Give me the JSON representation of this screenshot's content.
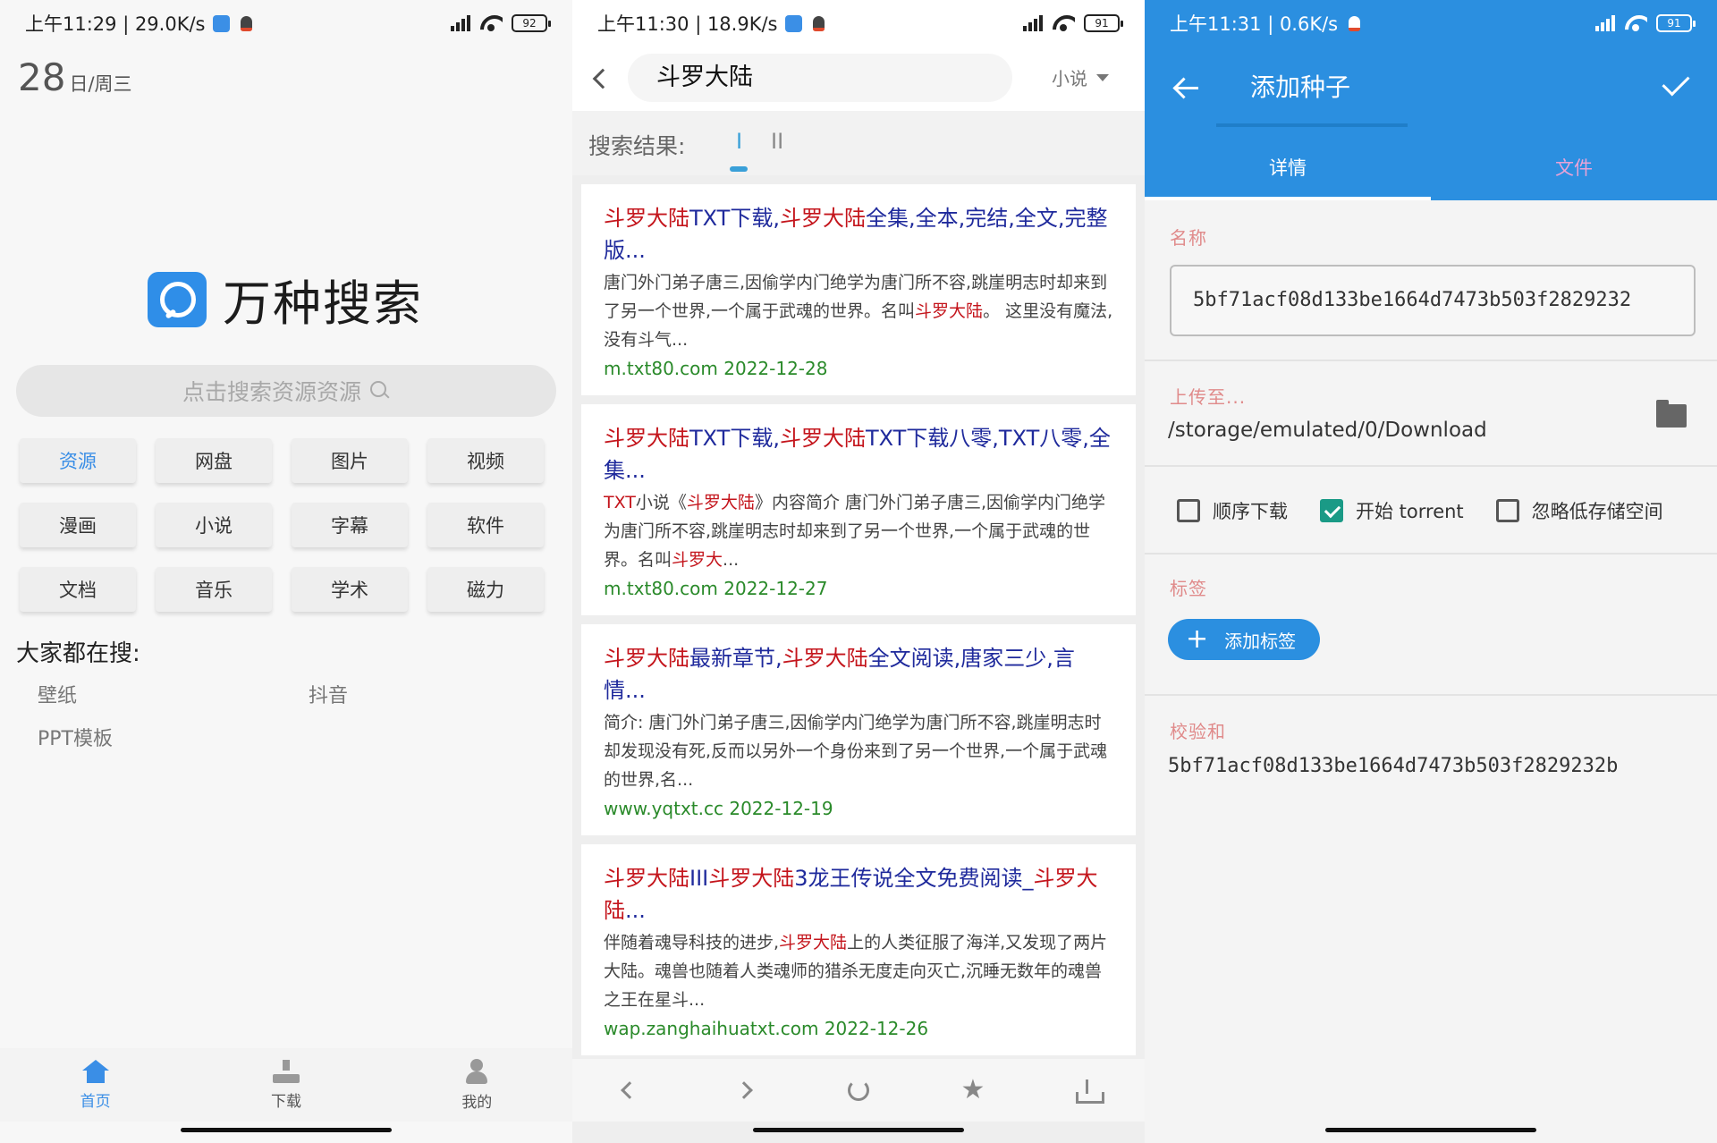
{
  "panel1": {
    "status": {
      "text": "上午11:29 | 29.0K/s",
      "battery": "92"
    },
    "date": {
      "day": "28",
      "weekday": "日/周三"
    },
    "app_name": "万种搜索",
    "search_placeholder": "点击搜索资源资源",
    "categories": [
      "资源",
      "网盘",
      "图片",
      "视频",
      "漫画",
      "小说",
      "字幕",
      "软件",
      "文档",
      "音乐",
      "学术",
      "磁力"
    ],
    "hot_title": "大家都在搜:",
    "hot_items": [
      "壁纸",
      "抖音",
      "PPT模板"
    ],
    "nav": [
      "首页",
      "下载",
      "我的"
    ]
  },
  "panel2": {
    "status": {
      "text": "上午11:30 | 18.9K/s",
      "battery": "91"
    },
    "query": "斗罗大陆",
    "category": "小说",
    "results_label": "搜索结果:",
    "result_tabs": [
      "I",
      "II"
    ],
    "results": [
      {
        "title": [
          {
            "t": "斗罗大陆",
            "h": true
          },
          {
            "t": "TXT下载,",
            "h": false
          },
          {
            "t": "斗罗大陆",
            "h": true
          },
          {
            "t": "全集,全本,完结,全文,完整版...",
            "h": false
          }
        ],
        "snippet": [
          {
            "t": "唐门外门弟子唐三,因偷学内门绝学为唐门所不容,跳崖明志时却来到了另一个世界,一个属于武魂的世界。名叫",
            "h": false
          },
          {
            "t": "斗罗大陆",
            "h": true
          },
          {
            "t": "。 这里没有魔法,没有斗气...",
            "h": false
          }
        ],
        "url": "m.txt80.com 2022-12-28"
      },
      {
        "title": [
          {
            "t": "斗罗大陆",
            "h": true
          },
          {
            "t": "TXT下载,",
            "h": false
          },
          {
            "t": "斗罗大陆",
            "h": true
          },
          {
            "t": "TXT下载八零,TXT八零,全集...",
            "h": false
          }
        ],
        "snippet": [
          {
            "t": "TXT",
            "h": true
          },
          {
            "t": "小说《",
            "h": false
          },
          {
            "t": "斗罗大陆",
            "h": true
          },
          {
            "t": "》内容简介 唐门外门弟子唐三,因偷学内门绝学为唐门所不容,跳崖明志时却来到了另一个世界,一个属于武魂的世界。名叫",
            "h": false
          },
          {
            "t": "斗罗大",
            "h": true
          },
          {
            "t": "...",
            "h": false
          }
        ],
        "url": "m.txt80.com 2022-12-27"
      },
      {
        "title": [
          {
            "t": "斗罗大陆",
            "h": true
          },
          {
            "t": "最新章节,",
            "h": false
          },
          {
            "t": "斗罗大陆",
            "h": true
          },
          {
            "t": "全文阅读,唐家三少,言情...",
            "h": false
          }
        ],
        "snippet": [
          {
            "t": "简介: 唐门外门弟子唐三,因偷学内门绝学为唐门所不容,跳崖明志时却发现没有死,反而以另外一个身份来到了另一个世界,一个属于武魂的世界,名...",
            "h": false
          }
        ],
        "url": "www.yqtxt.cc 2022-12-19"
      },
      {
        "title": [
          {
            "t": "斗罗大陆",
            "h": true
          },
          {
            "t": "III",
            "h": false
          },
          {
            "t": "斗罗大陆",
            "h": true
          },
          {
            "t": "3龙王传说全文免费阅读_",
            "h": false
          },
          {
            "t": "斗罗大陆",
            "h": true
          },
          {
            "t": "...",
            "h": false
          }
        ],
        "snippet": [
          {
            "t": "伴随着魂导科技的进步,",
            "h": false
          },
          {
            "t": "斗罗大陆",
            "h": true
          },
          {
            "t": "上的人类征服了海洋,又发现了两片大陆。魂兽也随着人类魂师的猎杀无度走向灭亡,沉睡无数年的魂兽之王在星斗...",
            "h": false
          }
        ],
        "url": "wap.zanghaihuatxt.com 2022-12-26"
      }
    ]
  },
  "panel3": {
    "status": {
      "text": "上午11:31 | 0.6K/s",
      "battery": "91"
    },
    "title": "添加种子",
    "tabs": [
      "详情",
      "文件"
    ],
    "name_label": "名称",
    "name_value": "5bf71acf08d133be1664d7473b503f2829232",
    "upload_label": "上传至...",
    "upload_path": "/storage/emulated/0/Download",
    "options": [
      {
        "label": "顺序下载",
        "checked": false
      },
      {
        "label": "开始 torrent",
        "checked": true
      },
      {
        "label": "忽略低存储空间",
        "checked": false
      }
    ],
    "tags_label": "标签",
    "add_tag": "添加标签",
    "checksum_label": "校验和",
    "checksum_value": "5bf71acf08d133be1664d7473b503f2829232b"
  },
  "colors": {
    "accent": "#2b8fe0",
    "highlight": "#c4151c",
    "link": "#1f2a9c",
    "url": "#2a8a2a",
    "check": "#1a9a86"
  }
}
